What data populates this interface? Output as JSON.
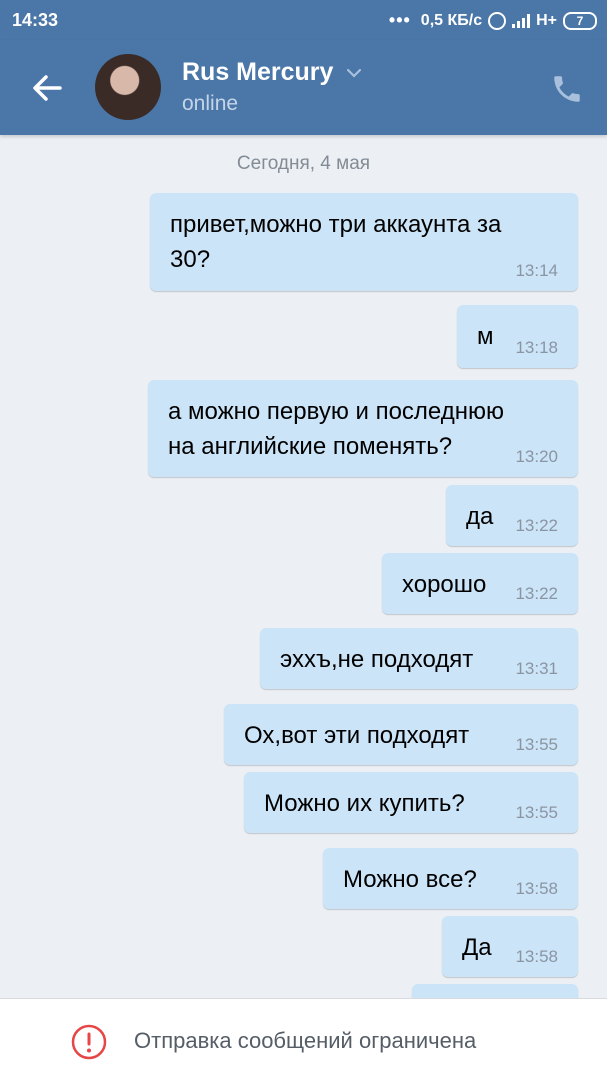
{
  "status_bar": {
    "time": "14:33",
    "net_speed": "0,5 КБ/с",
    "network": "H+",
    "battery": "7"
  },
  "header": {
    "contact_name": "Rus Mercury",
    "contact_status": "online"
  },
  "chat": {
    "date_separator": "Сегодня, 4 мая",
    "messages": [
      {
        "text": "привет,можно три аккаунта за",
        "text2": "30?",
        "time": "13:14"
      },
      {
        "text": "м",
        "time": "13:18"
      },
      {
        "text": "а можно первую и последнюю",
        "text2": "на английские поменять?",
        "time": "13:20"
      },
      {
        "text": "да",
        "time": "13:22"
      },
      {
        "text": "хорошо",
        "time": "13:22"
      },
      {
        "text": "эххъ,не подходят",
        "time": "13:31"
      },
      {
        "text": "Ох,вот эти подходят",
        "time": "13:55"
      },
      {
        "text": "Можно их купить?",
        "time": "13:55"
      },
      {
        "text": "Можно все?",
        "time": "13:58"
      },
      {
        "text": "Да",
        "time": "13:58"
      }
    ]
  },
  "bottom_bar": {
    "notice": "Отправка сообщений ограничена"
  },
  "colors": {
    "header_bg": "#4a76a8",
    "chat_bg": "#ecf0f4",
    "outgoing_bubble": "#cce4f7",
    "warning_red": "#e64646"
  }
}
